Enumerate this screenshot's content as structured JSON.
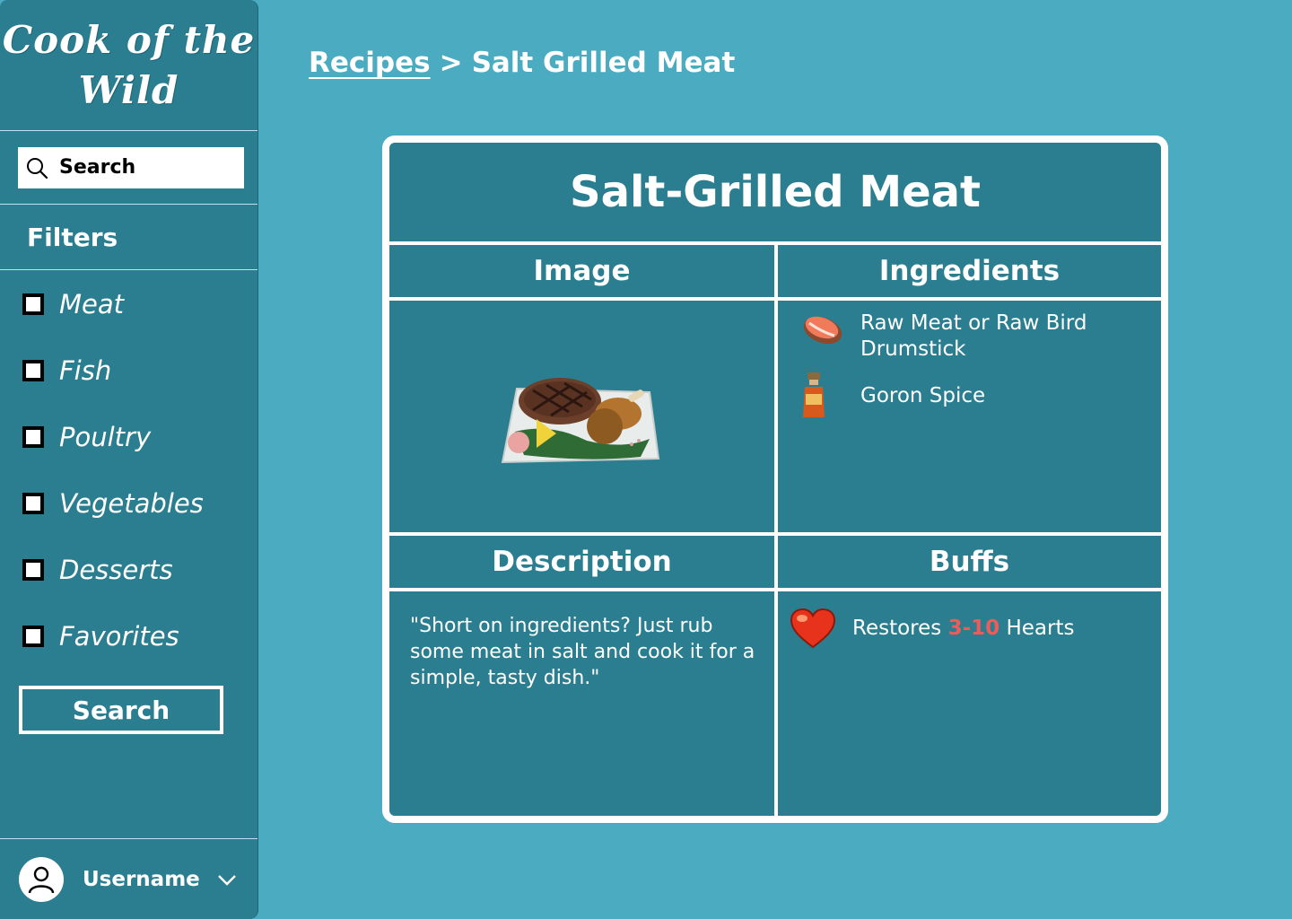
{
  "app": {
    "logo_line1": "Cook of the",
    "logo_line2": "Wild"
  },
  "sidebar": {
    "search_placeholder": "Search",
    "filters_title": "Filters",
    "filters": [
      {
        "label": "Meat",
        "checked": false
      },
      {
        "label": "Fish",
        "checked": false
      },
      {
        "label": "Poultry",
        "checked": false
      },
      {
        "label": "Vegetables",
        "checked": false
      },
      {
        "label": "Desserts",
        "checked": false
      },
      {
        "label": "Favorites",
        "checked": false
      }
    ],
    "search_button": "Search",
    "username": "Username"
  },
  "breadcrumb": {
    "root": "Recipes",
    "separator": ">",
    "current": "Salt Grilled Meat"
  },
  "recipe": {
    "title": "Salt-Grilled Meat",
    "headers": {
      "image": "Image",
      "ingredients": "Ingredients",
      "description": "Description",
      "buffs": "Buffs"
    },
    "ingredients": [
      {
        "name": "Raw Meat or Raw Bird Drumstick",
        "icon": "raw-meat-icon"
      },
      {
        "name": "Goron Spice",
        "icon": "goron-spice-icon"
      }
    ],
    "description": "\"Short on ingredients? Just rub some meat in salt and cook it for a simple, tasty dish.\"",
    "buff": {
      "prefix": "Restores ",
      "value": "3-10",
      "suffix": " Hearts",
      "icon": "heart-icon"
    }
  },
  "colors": {
    "background": "#4aabc1",
    "panel": "#2a7e90",
    "highlight": "#f05a5a"
  }
}
